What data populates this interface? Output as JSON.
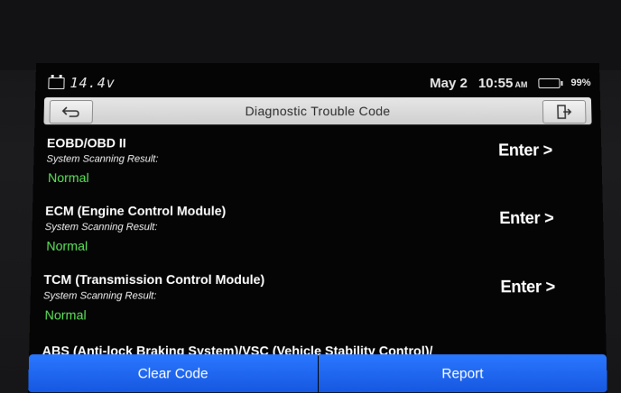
{
  "status_bar": {
    "voltage": "14.4v",
    "date": "May 2",
    "time": "10:55",
    "ampm": "AM",
    "battery_percent": "99%",
    "battery_level": 0.99,
    "battery_color": "#3ddc2e"
  },
  "header": {
    "title": "Diagnostic Trouble Code",
    "back_icon": "back-arrow-icon",
    "exit_icon": "exit-door-icon"
  },
  "modules": [
    {
      "name": "EOBD/OBD II",
      "scan_label": "System Scanning Result:",
      "result": "Normal",
      "action": "Enter >"
    },
    {
      "name": "ECM (Engine Control Module)",
      "scan_label": "System Scanning Result:",
      "result": "Normal",
      "action": "Enter >"
    },
    {
      "name": "TCM (Transmission Control Module)",
      "scan_label": "System Scanning Result:",
      "result": "Normal",
      "action": "Enter >"
    },
    {
      "name": "ABS (Anti-lock Braking System)/VSC (Vehicle Stability Control)/"
    }
  ],
  "footer": {
    "clear_code_label": "Clear Code",
    "report_label": "Report",
    "button_color": "#2a77ff"
  },
  "colors": {
    "result_normal": "#5ee35a",
    "background": "#050505",
    "title_bar": "#dcdcdc"
  }
}
